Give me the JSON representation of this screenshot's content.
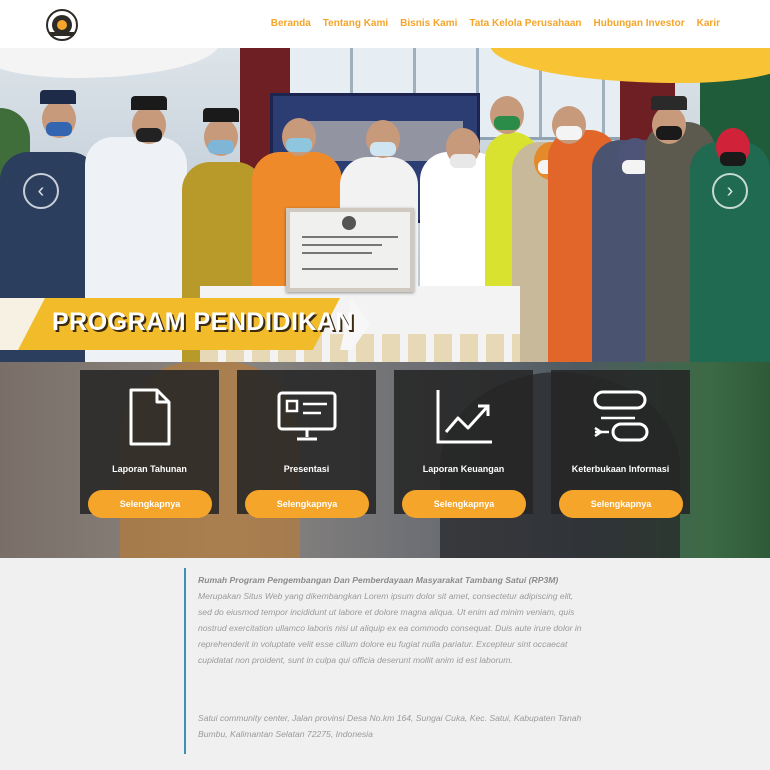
{
  "navbar": {
    "items": [
      {
        "label": "Beranda"
      },
      {
        "label": "Tentang Kami"
      },
      {
        "label": "Bisnis Kami"
      },
      {
        "label": "Tata Kelola Perusahaan"
      },
      {
        "label": "Hubungan Investor"
      },
      {
        "label": "Karir"
      }
    ]
  },
  "hero": {
    "banner_title": "PROGRAM PENDIDIKAN",
    "prev_icon": "chevron-left-icon",
    "next_icon": "chevron-right-icon"
  },
  "cards": [
    {
      "label": "Laporan Tahunan",
      "button": "Selengkapnya",
      "icon": "document-icon"
    },
    {
      "label": "Presentasi",
      "button": "Selengkapnya",
      "icon": "presentation-icon"
    },
    {
      "label": "Laporan Keuangan",
      "button": "Selengkapnya",
      "icon": "chart-line-icon"
    },
    {
      "label": "Keterbukaan Informasi",
      "button": "Selengkapnya",
      "icon": "switch-icon"
    }
  ],
  "info": {
    "title": "Rumah Program Pengembangan Dan Pemberdayaan Masyarakat Tambang Satui (RP3M)",
    "body": " Merupakan Situs Web yang dikembangkan Lorem ipsum dolor sit amet, consectetur adipiscing elit, sed do eiusmod tempor incididunt ut labore et dolore magna aliqua. Ut enim ad minim veniam, quis nostrud exercitation ullamco laboris nisi ut aliquip ex ea commodo consequat. Duis aute irure dolor in reprehenderit in voluptate velit esse cillum dolore eu fugiat nulla pariatur. Excepteur sint occaecat cupidatat non proident, sunt in culpa qui officia deserunt mollit anim id est laborum.",
    "address": "Satui community center, Jalan provinsi Desa No.km 164, Sungai Cuka, Kec. Satui, Kabupaten Tanah Bumbu, Kalimantan Selatan 72275, Indonesia"
  },
  "colors": {
    "accent": "#f4a52a",
    "banner_yellow": "#f2bb2a",
    "info_bar": "#3d8fb5"
  }
}
